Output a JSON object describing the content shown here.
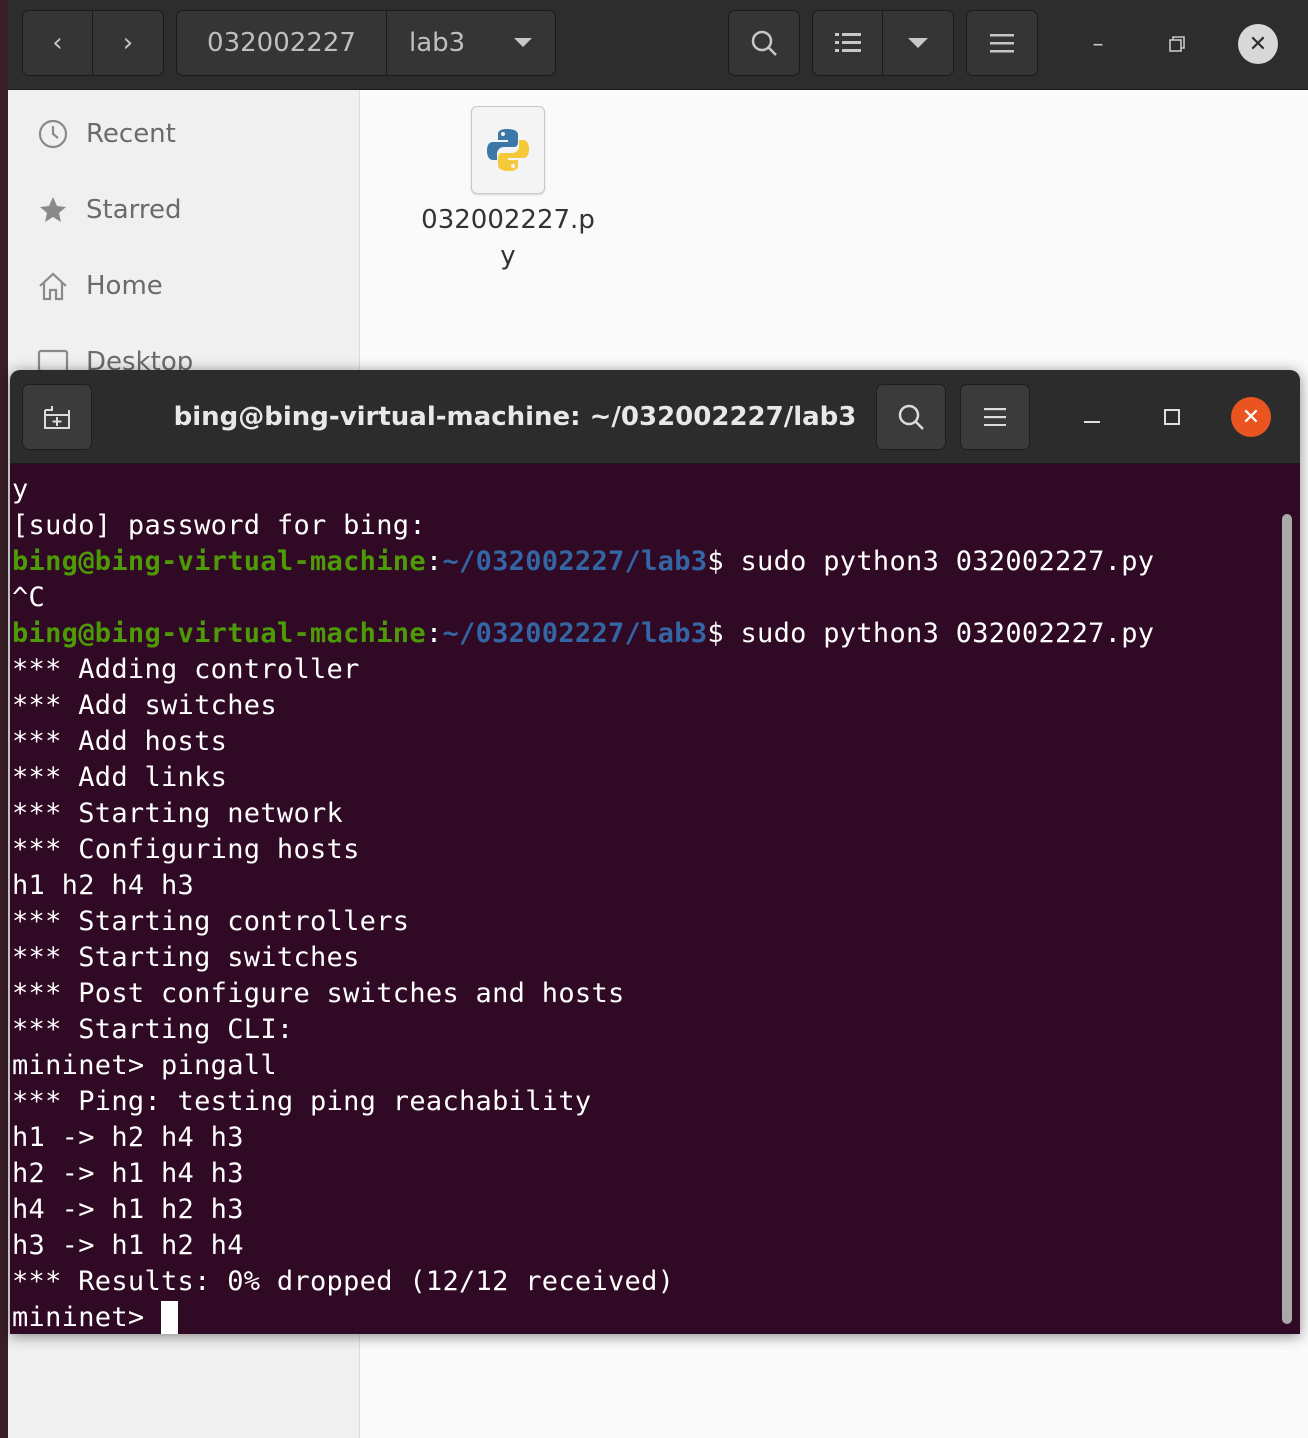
{
  "files_window": {
    "breadcrumb": [
      "032002227",
      "lab3"
    ],
    "sidebar": [
      {
        "label": "Recent",
        "icon": "clock-icon"
      },
      {
        "label": "Starred",
        "icon": "star-icon"
      },
      {
        "label": "Home",
        "icon": "home-icon"
      },
      {
        "label": "Desktop",
        "icon": "desktop-icon"
      }
    ],
    "files": [
      {
        "name": "032002227.py",
        "icon": "python-file-icon"
      }
    ]
  },
  "terminal": {
    "title": "bing@bing-virtual-machine: ~/032002227/lab3",
    "prompt": {
      "user": "bing@bing-virtual-machine",
      "sep": ":",
      "path": "~/032002227/lab3",
      "dollar": "$ "
    },
    "lines": [
      {
        "text": "y"
      },
      {
        "text": "[sudo] password for bing:"
      },
      {
        "prompt": true,
        "cmd": "sudo python3 032002227.py"
      },
      {
        "text": "^C"
      },
      {
        "prompt": true,
        "cmd": "sudo python3 032002227.py"
      },
      {
        "text": "*** Adding controller"
      },
      {
        "text": "*** Add switches"
      },
      {
        "text": "*** Add hosts"
      },
      {
        "text": "*** Add links"
      },
      {
        "text": "*** Starting network"
      },
      {
        "text": "*** Configuring hosts"
      },
      {
        "text": "h1 h2 h4 h3"
      },
      {
        "text": "*** Starting controllers"
      },
      {
        "text": "*** Starting switches"
      },
      {
        "text": "*** Post configure switches and hosts"
      },
      {
        "text": "*** Starting CLI:"
      },
      {
        "text": "mininet> pingall"
      },
      {
        "text": "*** Ping: testing ping reachability"
      },
      {
        "text": "h1 -> h2 h4 h3"
      },
      {
        "text": "h2 -> h1 h4 h3"
      },
      {
        "text": "h4 -> h1 h2 h3"
      },
      {
        "text": "h3 -> h1 h2 h4"
      },
      {
        "text": "*** Results: 0% dropped (12/12 received)"
      },
      {
        "text": "mininet> ",
        "cursor": true
      }
    ]
  },
  "colors": {
    "terminal_bg": "#300a24",
    "prompt_user": "#4e9a06",
    "prompt_path": "#3465a4",
    "close_button": "#e95420"
  }
}
